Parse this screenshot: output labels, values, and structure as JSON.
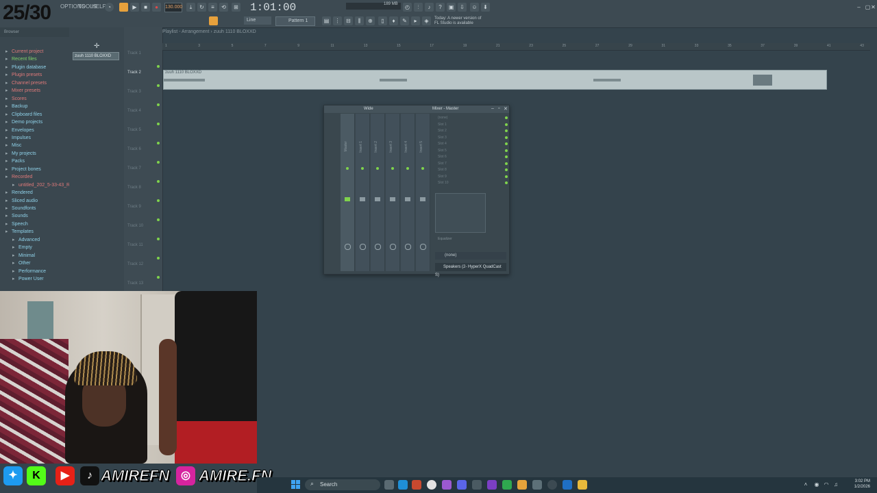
{
  "overlay": {
    "counter": "25/30"
  },
  "app": {
    "menu_items": [
      "OPTIONS",
      "TOOLS",
      "HELP"
    ],
    "tempo": "130.000",
    "time": "1:01:00",
    "memory": "189 MB",
    "news": [
      "Today: A newer version of",
      "FL Studio is available"
    ],
    "pattern": "Pattern 1",
    "snap": "Line"
  },
  "browser": {
    "header": "Browser",
    "items": [
      {
        "label": "Current project",
        "color": "#e07a7a"
      },
      {
        "label": "Recent files",
        "color": "#7fd36b"
      },
      {
        "label": "Plugin database",
        "color": "#8fd1e8"
      },
      {
        "label": "Plugin presets",
        "color": "#e07a7a"
      },
      {
        "label": "Channel presets",
        "color": "#e07a7a"
      },
      {
        "label": "Mixer presets",
        "color": "#e07a7a"
      },
      {
        "label": "Scores",
        "color": "#e07a7a"
      },
      {
        "label": "Backup",
        "color": "#8fd1e8"
      },
      {
        "label": "Clipboard files",
        "color": "#8fd1e8"
      },
      {
        "label": "Demo projects",
        "color": "#8fd1e8"
      },
      {
        "label": "Envelopes",
        "color": "#8fd1e8"
      },
      {
        "label": "Impulses",
        "color": "#8fd1e8"
      },
      {
        "label": "Misc",
        "color": "#8fd1e8"
      },
      {
        "label": "My projects",
        "color": "#8fd1e8"
      },
      {
        "label": "Packs",
        "color": "#8fd1e8"
      },
      {
        "label": "Project bones",
        "color": "#8fd1e8"
      },
      {
        "label": "Recorded",
        "color": "#e07a7a"
      },
      {
        "label": "untitled_202_5-33-43_REC",
        "color": "#e07a7a"
      },
      {
        "label": "Rendered",
        "color": "#8fd1e8"
      },
      {
        "label": "Sliced audio",
        "color": "#8fd1e8"
      },
      {
        "label": "Soundfonts",
        "color": "#8fd1e8"
      },
      {
        "label": "Sounds",
        "color": "#8fd1e8"
      },
      {
        "label": "Speech",
        "color": "#8fd1e8"
      },
      {
        "label": "Templates",
        "color": "#8fd1e8"
      },
      {
        "label": "Advanced",
        "color": "#8fd1e8"
      },
      {
        "label": "Empty",
        "color": "#8fd1e8"
      },
      {
        "label": "Minimal",
        "color": "#8fd1e8"
      },
      {
        "label": "Other",
        "color": "#8fd1e8"
      },
      {
        "label": "Performance",
        "color": "#8fd1e8"
      },
      {
        "label": "Power User",
        "color": "#8fd1e8"
      }
    ]
  },
  "playlist": {
    "title": "Playlist - Arrangement › zuuh 1110 BLOXXD",
    "pattern_block": "zuuh 1110 BLOXXD",
    "clip_label": "zuuh 1110 BLOXXD",
    "tracks": [
      "Track 1",
      "Track 2",
      "Track 3",
      "Track 4",
      "Track 5",
      "Track 6",
      "Track 7",
      "Track 8",
      "Track 9",
      "Track 10",
      "Track 11",
      "Track 12",
      "Track 13"
    ],
    "ruler": [
      "1",
      "3",
      "5",
      "7",
      "9",
      "11",
      "13",
      "15",
      "17",
      "19",
      "21",
      "23",
      "25",
      "27",
      "29",
      "31",
      "33",
      "35",
      "37",
      "39",
      "41",
      "43"
    ]
  },
  "mixer": {
    "wide_label": "Wide",
    "title": "Mixer - Master",
    "strips": [
      "Master",
      "Insert 1",
      "Insert 2",
      "Insert 3",
      "Insert 4",
      "Insert 5"
    ],
    "slots": [
      "(none)",
      "Slot 1",
      "Slot 2",
      "Slot 3",
      "Slot 4",
      "Slot 5",
      "Slot 6",
      "Slot 7",
      "Slot 8",
      "Slot 9",
      "Slot 10"
    ],
    "equalizer_label": "Equalizer",
    "input": "(none)",
    "output": "Speakers (2- HyperX QuadCast S)"
  },
  "socials": {
    "handle1": "AMIREFN",
    "handle2": "AMIRE.FN"
  },
  "taskbar": {
    "search": "Search",
    "time": "3:02 PM",
    "date": "1/2/2026"
  }
}
